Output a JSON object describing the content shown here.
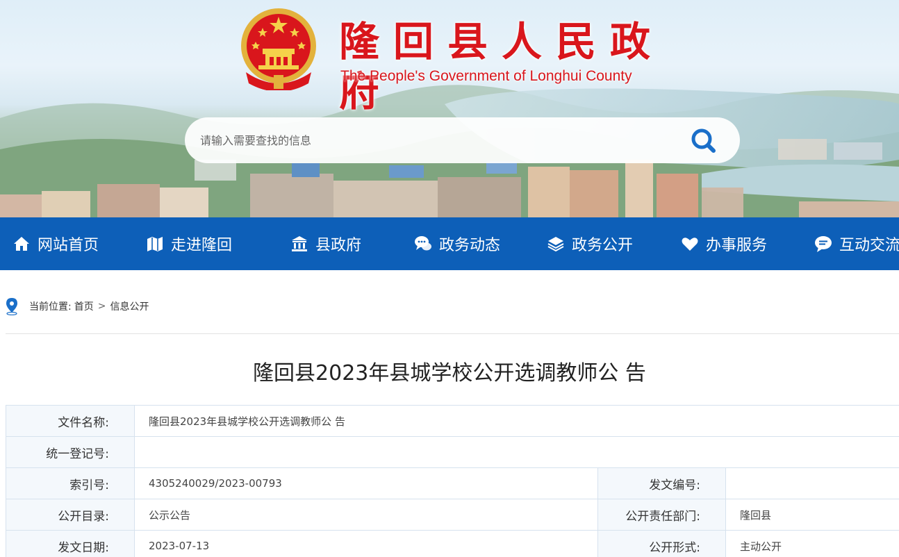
{
  "site": {
    "title_cn": "隆回县人民政府",
    "title_en": "The People's Government of Longhui County"
  },
  "search": {
    "placeholder": "请输入需要查找的信息"
  },
  "nav": {
    "items": [
      {
        "label": "网站首页",
        "icon": "home-icon"
      },
      {
        "label": "走进隆回",
        "icon": "map-icon"
      },
      {
        "label": "县政府",
        "icon": "government-building-icon"
      },
      {
        "label": "政务动态",
        "icon": "chat-bubbles-icon"
      },
      {
        "label": "政务公开",
        "icon": "layers-icon"
      },
      {
        "label": "办事服务",
        "icon": "heart-icon"
      },
      {
        "label": "互动交流",
        "icon": "comment-icon"
      }
    ]
  },
  "breadcrumb": {
    "prefix": "当前位置:",
    "items": [
      "首页",
      "信息公开"
    ],
    "separator": ">"
  },
  "article": {
    "title": "隆回县2023年县城学校公开选调教师公 告",
    "meta": {
      "file_name_label": "文件名称:",
      "file_name": "隆回县2023年县城学校公开选调教师公 告",
      "reg_no_label": "统一登记号:",
      "reg_no": "",
      "index_label": "索引号:",
      "index": "4305240029/2023-00793",
      "doc_no_label": "发文编号:",
      "doc_no": "",
      "catalog_label": "公开目录:",
      "catalog": "公示公告",
      "dept_label": "公开责任部门:",
      "dept": "隆回县",
      "date_label": "发文日期:",
      "date": "2023-07-13",
      "form_label": "公开形式:",
      "form": "主动公开"
    }
  },
  "colors": {
    "brand_red": "#d9161c",
    "nav_blue": "#0d5fb8",
    "accent_blue": "#1a6fc9"
  }
}
